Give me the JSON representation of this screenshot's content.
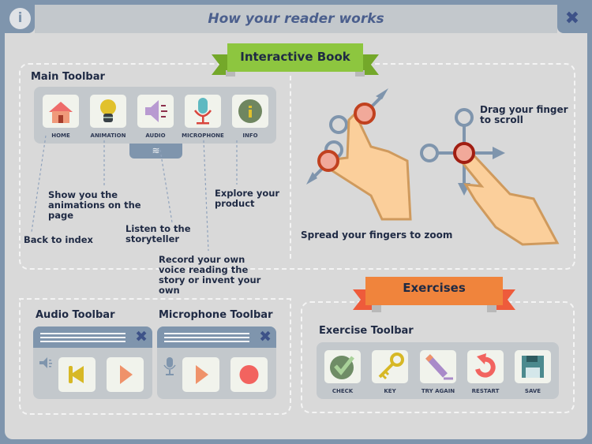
{
  "header": {
    "title": "How your reader works",
    "info_icon": "info-icon",
    "close_icon": "close-icon",
    "info_glyph": "i",
    "close_glyph": "✖"
  },
  "interactive_book": {
    "ribbon": "Interactive Book",
    "main_toolbar": {
      "title": "Main Toolbar",
      "tools": [
        {
          "label": "HOME",
          "icon": "home-icon"
        },
        {
          "label": "ANIMATION",
          "icon": "lightbulb-icon"
        },
        {
          "label": "AUDIO",
          "icon": "speaker-icon"
        },
        {
          "label": "MICROPHONE",
          "icon": "microphone-icon"
        },
        {
          "label": "INFO",
          "icon": "info-icon"
        }
      ],
      "notes": {
        "home": "Back to index",
        "animation": "Show you the animations on the page",
        "audio": "Listen to the storyteller",
        "microphone": "Record your own voice reading the story or invent your own",
        "info": "Explore your product"
      }
    },
    "gestures": {
      "zoom": "Spread your fingers to zoom",
      "scroll": "Drag your finger to scroll"
    },
    "audio_toolbar": {
      "title": "Audio Toolbar",
      "buttons": [
        "rewind-icon",
        "play-icon"
      ]
    },
    "microphone_toolbar": {
      "title": "Microphone Toolbar",
      "buttons": [
        "play-icon",
        "record-icon"
      ]
    }
  },
  "exercises": {
    "ribbon": "Exercises",
    "toolbar": {
      "title": "Exercise Toolbar",
      "tools": [
        {
          "label": "CHECK",
          "icon": "check-icon"
        },
        {
          "label": "KEY",
          "icon": "key-icon"
        },
        {
          "label": "TRY AGAIN",
          "icon": "pencil-icon"
        },
        {
          "label": "RESTART",
          "icon": "restart-icon"
        },
        {
          "label": "SAVE",
          "icon": "save-icon"
        }
      ]
    }
  },
  "colors": {
    "green_ribbon": "#8dc63f",
    "orange_ribbon": "#f0843c",
    "frame": "#7f95ad",
    "title_text": "#4b5f8d"
  }
}
